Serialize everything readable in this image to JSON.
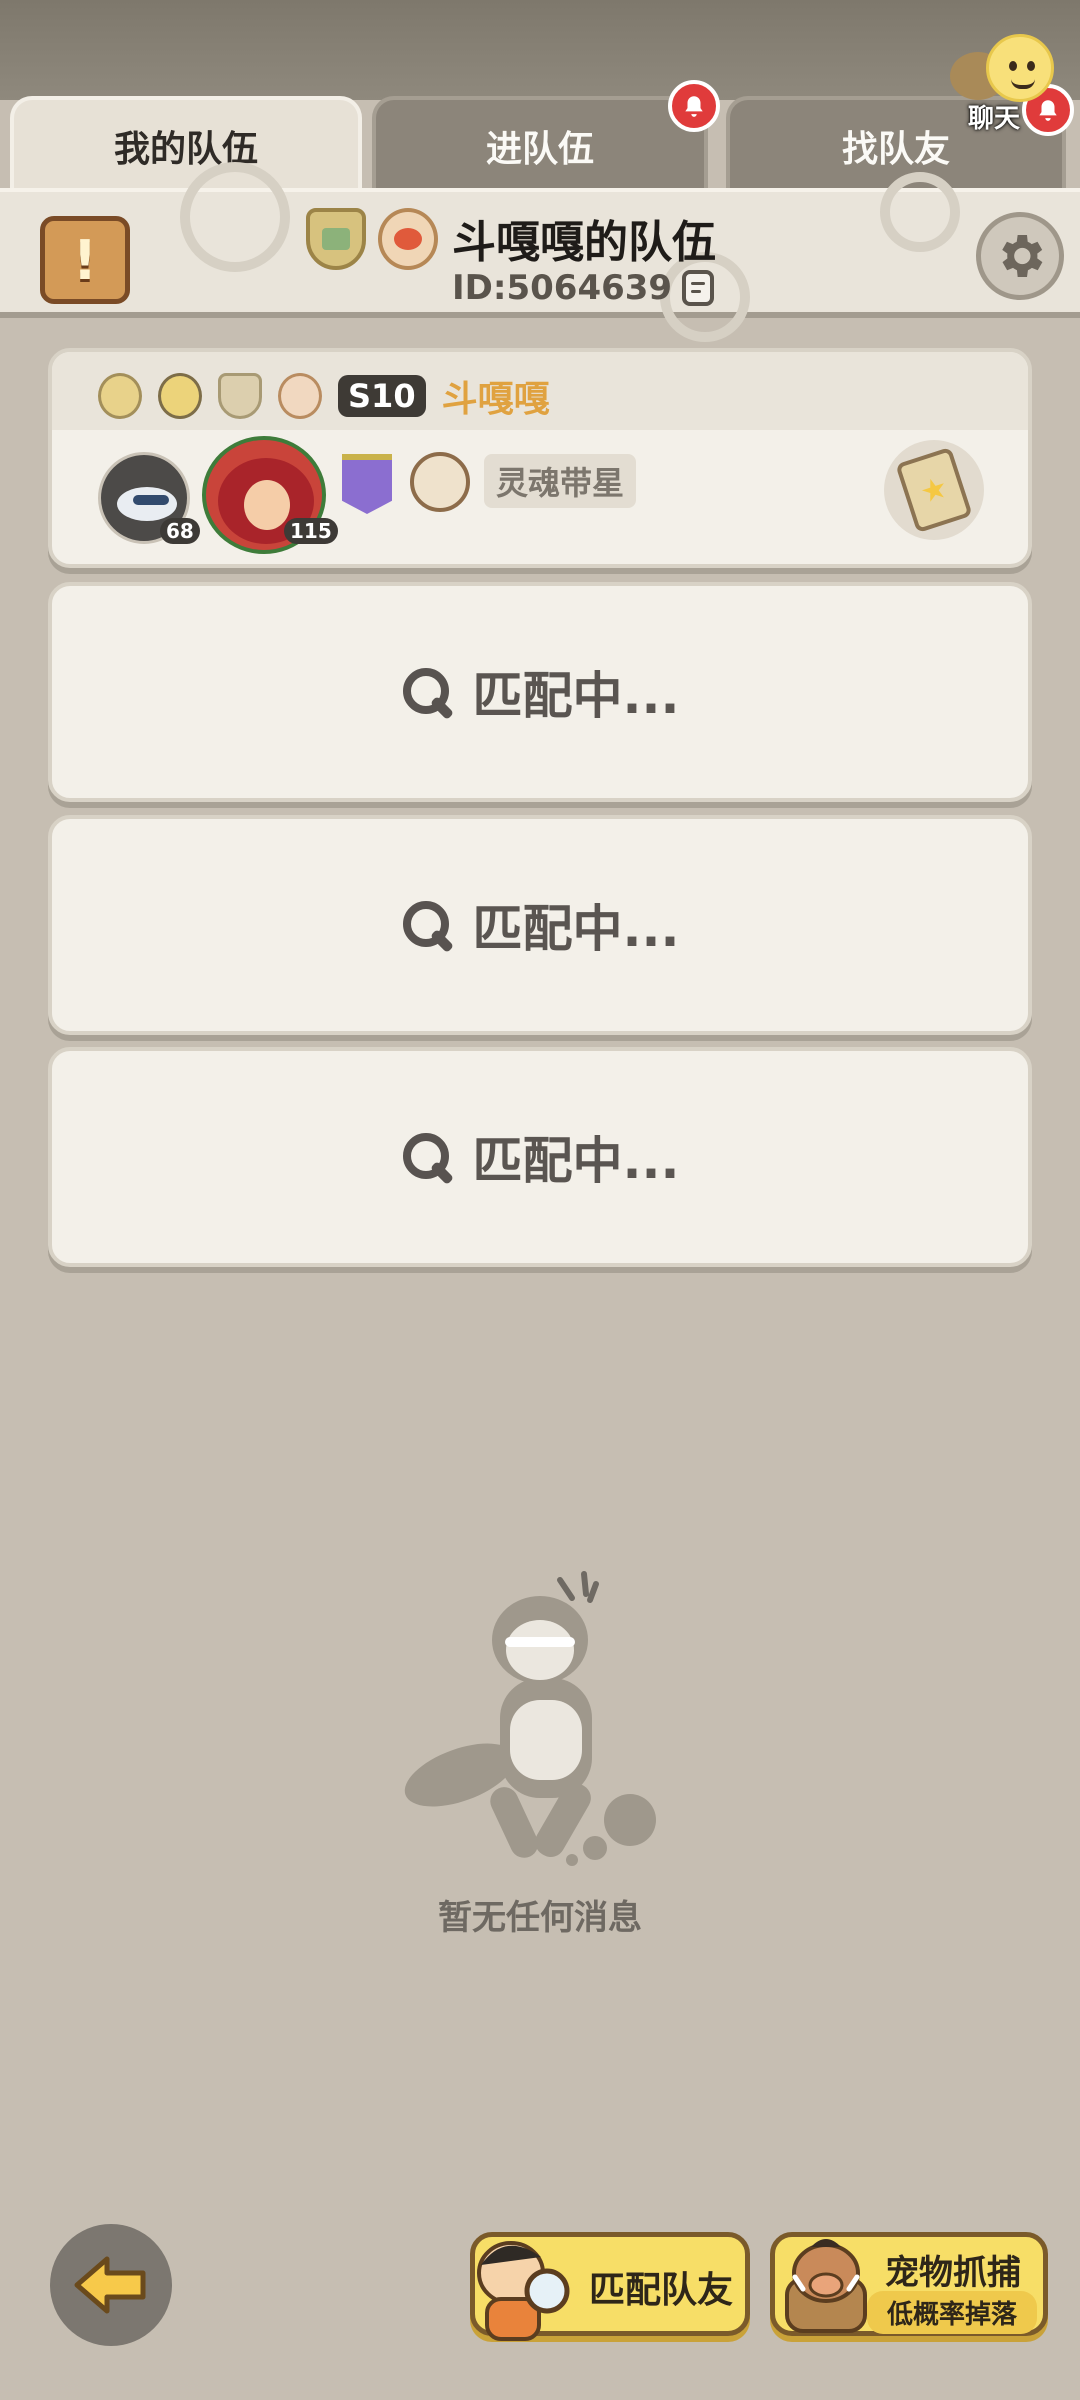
{
  "tabs": {
    "my_team": "我的队伍",
    "join_team": "进队伍",
    "find_teammate": "找队友"
  },
  "chat": {
    "label": "聊天"
  },
  "header": {
    "team_name": "斗嘎嘎的队伍",
    "team_id": "ID:5064639"
  },
  "member": {
    "season": "S10",
    "name": "斗嘎嘎",
    "pet_level": "68",
    "hero_level": "115",
    "soul_label": "灵魂带星"
  },
  "slots": [
    {
      "text": "匹配中..."
    },
    {
      "text": "匹配中..."
    },
    {
      "text": "匹配中..."
    }
  ],
  "empty": {
    "message": "暂无任何消息"
  },
  "actions": {
    "match_label": "匹配队友",
    "pet_title": "宠物抓捕",
    "pet_sub": "低概率掉落"
  },
  "colors": {
    "background": "#c6beb2",
    "panel": "#f3f0e9",
    "accent_yellow": "#f7de67",
    "notify_red": "#e03b3b",
    "member_name": "#e0a240"
  }
}
